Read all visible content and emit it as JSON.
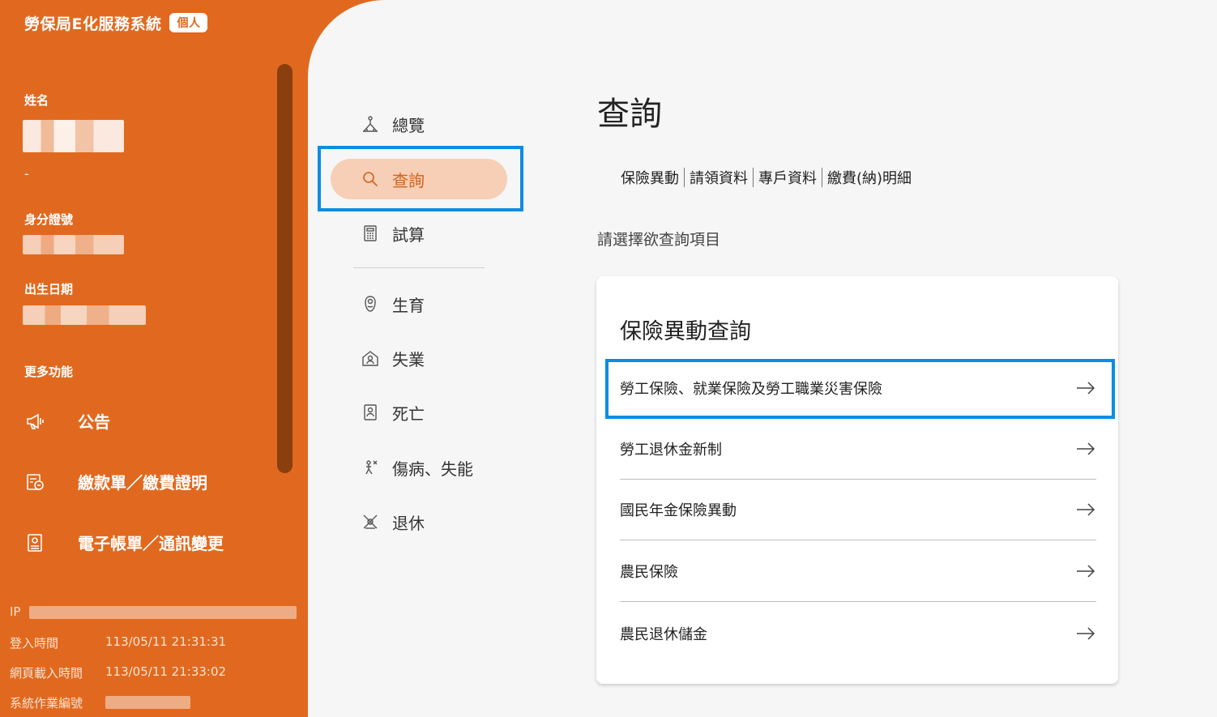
{
  "app": {
    "title": "勞保局E化服務系統",
    "badge": "個人"
  },
  "profile": {
    "name_label": "姓名",
    "name_extra": "-",
    "id_label": "身分證號",
    "birth_label": "出生日期"
  },
  "more": {
    "label": "更多功能",
    "items": [
      {
        "label": "公告",
        "icon": "megaphone-icon"
      },
      {
        "label": "繳款單／繳費證明",
        "icon": "bill-icon"
      },
      {
        "label": "電子帳單／通訊變更",
        "icon": "document-icon"
      }
    ]
  },
  "session": {
    "ip_label": "IP",
    "login_label": "登入時間",
    "login_value": "113/05/11 21:31:31",
    "load_label": "網頁載入時間",
    "load_value": "113/05/11 21:33:02",
    "job_label": "系統作業編號"
  },
  "menu": {
    "top": [
      {
        "label": "總覽",
        "icon": "overview-icon"
      },
      {
        "label": "查詢",
        "icon": "search-icon",
        "active": true
      },
      {
        "label": "試算",
        "icon": "calculator-icon"
      }
    ],
    "bottom": [
      {
        "label": "生育",
        "icon": "baby-icon"
      },
      {
        "label": "失業",
        "icon": "unemployment-icon"
      },
      {
        "label": "死亡",
        "icon": "death-icon"
      },
      {
        "label": "傷病、失能",
        "icon": "injury-icon"
      },
      {
        "label": "退休",
        "icon": "retirement-icon"
      }
    ]
  },
  "main": {
    "title": "查詢",
    "tabs": [
      "保險異動",
      "請領資料",
      "專戶資料",
      "繳費(納)明細"
    ],
    "prompt": "請選擇欲查詢項目",
    "card": {
      "title": "保險異動查詢",
      "rows": [
        "勞工保險、就業保險及勞工職業災害保險",
        "勞工退休金新制",
        "國民年金保險異動",
        "農民保險",
        "農民退休儲金"
      ]
    }
  },
  "colors": {
    "brand": "#e1691f",
    "active_bg": "#f6cfb6",
    "highlight": "#0b8de3"
  }
}
